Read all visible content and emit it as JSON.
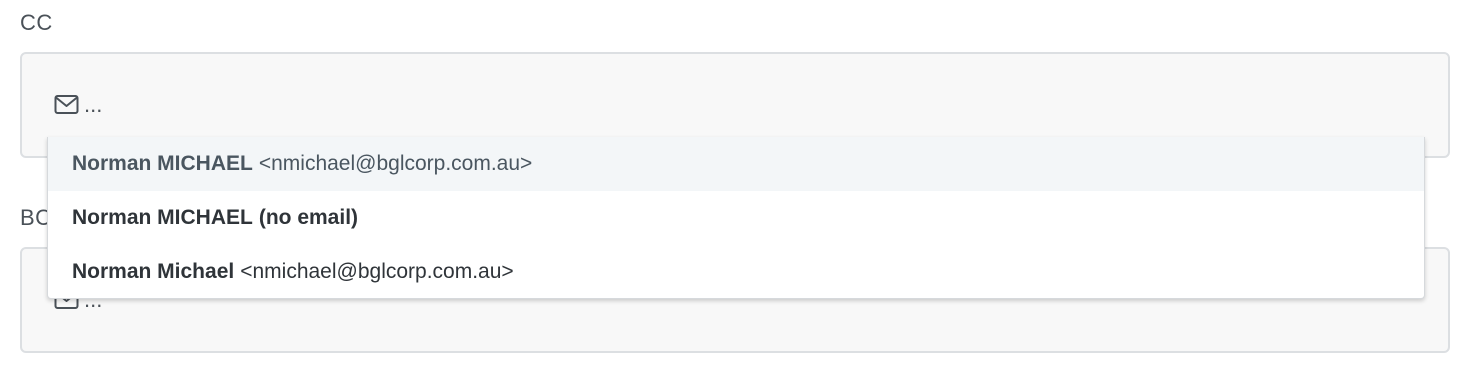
{
  "cc": {
    "label": "CC",
    "placeholder": "...",
    "icon": "envelope-icon"
  },
  "bcc": {
    "label": "BCC",
    "placeholder": "...",
    "icon": "envelope-icon"
  },
  "suggestions": [
    {
      "name": "Norman MICHAEL",
      "detail": "<nmichael@bglcorp.com.au>",
      "highlighted": true
    },
    {
      "name": "Norman MICHAEL",
      "detail": "(no email)",
      "highlighted": false
    },
    {
      "name": "Norman Michael",
      "detail": "<nmichael@bglcorp.com.au>",
      "highlighted": false
    }
  ],
  "colors": {
    "highlight_bg": "#f3f6f8",
    "field_bg": "#f8f8f8",
    "field_border": "#dcdfe2"
  }
}
